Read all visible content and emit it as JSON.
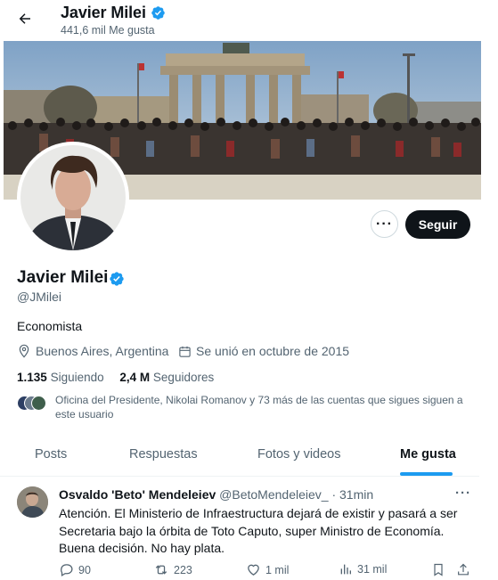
{
  "header": {
    "back_icon": "arrow-left-icon",
    "title": "Javier Milei",
    "likes_count": "441,6 mil Me gusta"
  },
  "profile": {
    "name": "Javier Milei",
    "handle": "@JMilei",
    "bio": "Economista",
    "location": "Buenos Aires, Argentina",
    "joined": "Se unió en octubre de 2015",
    "following_count": "1.135",
    "following_label": "Siguiendo",
    "followers_count": "2,4 M",
    "followers_label": "Seguidores",
    "known_followers": "Oficina del Presidente, Nikolai Romanov y 73 más de las cuentas que sigues siguen a este usuario",
    "follow_button": "Seguir",
    "verified_color": "#1d9bf0"
  },
  "tabs": [
    {
      "label": "Posts",
      "active": false
    },
    {
      "label": "Respuestas",
      "active": false
    },
    {
      "label": "Fotos y videos",
      "active": false
    },
    {
      "label": "Me gusta",
      "active": true
    }
  ],
  "tweet": {
    "author": "Osvaldo 'Beto' Mendeleiev",
    "handle": "@BetoMendeleiev_",
    "time": "· 31min",
    "text": "Atención. El Ministerio de Infraestructura dejará de existir y pasará a ser Secretaria bajo la órbita de Toto Caputo, super Ministro de Economía. Buena decisión. No hay plata.",
    "replies": "90",
    "reposts": "223",
    "likes": "1 mil",
    "views": "31 mil"
  },
  "colors": {
    "accent": "#1d9bf0",
    "text_primary": "#0f1419",
    "text_secondary": "#536471",
    "follow_button_bg": "#0f1419"
  }
}
